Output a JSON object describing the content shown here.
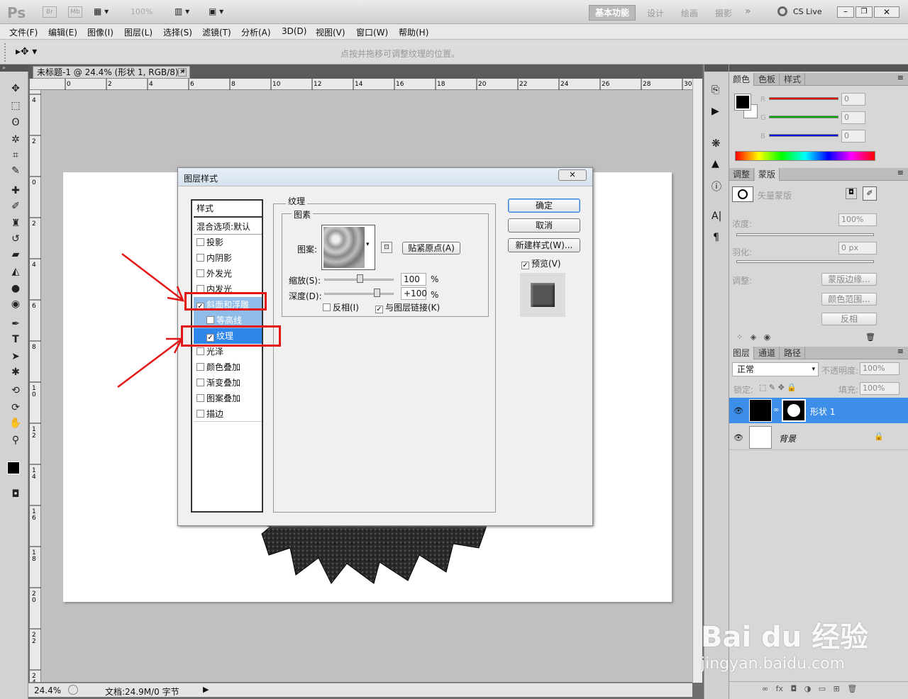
{
  "app": {
    "logo": "Ps",
    "br": "Br",
    "mb": "Mb",
    "zoom": "100%",
    "workspaces": [
      "基本功能",
      "设计",
      "绘画",
      "摄影"
    ],
    "more": "»",
    "cslive": "CS Live",
    "hint": "点按并拖移可调整纹理的位置。"
  },
  "menu": [
    "文件(F)",
    "编辑(E)",
    "图像(I)",
    "图层(L)",
    "选择(S)",
    "滤镜(T)",
    "分析(A)",
    "3D(D)",
    "视图(V)",
    "窗口(W)",
    "帮助(H)"
  ],
  "document": {
    "tab_title": "未标题-1 @ 24.4% (形状 1, RGB/8) *",
    "zoom": "24.4%",
    "doc_info": "文档:24.9M/0 字节"
  },
  "ruler": {
    "h_ticks": [
      "0",
      "2",
      "4",
      "6",
      "8",
      "10",
      "12",
      "14",
      "16",
      "18",
      "20",
      "22",
      "24",
      "26",
      "28",
      "30"
    ],
    "v_ticks": [
      "4",
      "2",
      "0",
      "2",
      "4",
      "6",
      "8",
      "1 0",
      "1 2",
      "1 4",
      "1 6",
      "1 8",
      "2 0",
      "2 2",
      "2 4"
    ]
  },
  "dialog": {
    "title": "图层样式",
    "styles_header": "样式",
    "blend_options": "混合选项:默认",
    "items": [
      {
        "label": "投影",
        "checked": false
      },
      {
        "label": "内阴影",
        "checked": false
      },
      {
        "label": "外发光",
        "checked": false
      },
      {
        "label": "内发光",
        "checked": false
      },
      {
        "label": "斜面和浮雕",
        "checked": true
      },
      {
        "label": "等高线",
        "checked": false
      },
      {
        "label": "纹理",
        "checked": true
      },
      {
        "label": "光泽",
        "checked": false
      },
      {
        "label": "颜色叠加",
        "checked": false
      },
      {
        "label": "渐变叠加",
        "checked": false
      },
      {
        "label": "图案叠加",
        "checked": false
      },
      {
        "label": "描边",
        "checked": false
      }
    ],
    "section_title": "纹理",
    "subsection": "图素",
    "pattern_label": "图案:",
    "snap_button": "贴紧原点(A)",
    "scale_label": "缩放(S):",
    "scale_value": "100",
    "depth_label": "深度(D):",
    "depth_value": "+100",
    "percent": "%",
    "invert_label": "反相(I)",
    "invert_checked": false,
    "link_label": "与图层链接(K)",
    "link_checked": true,
    "ok": "确定",
    "cancel": "取消",
    "new_style": "新建样式(W)...",
    "preview_label": "预览(V)",
    "preview_checked": true
  },
  "color_panel": {
    "tabs": [
      "颜色",
      "色板",
      "样式"
    ],
    "channels": [
      {
        "name": "R",
        "value": "0",
        "color": "#e00000"
      },
      {
        "name": "G",
        "value": "0",
        "color": "#00b000"
      },
      {
        "name": "B",
        "value": "0",
        "color": "#0000e0"
      }
    ]
  },
  "mask_panel": {
    "tabs": [
      "调整",
      "蒙版"
    ],
    "vector_mask": "矢量蒙版",
    "density_label": "浓度:",
    "density_value": "100%",
    "feather_label": "羽化:",
    "feather_value": "0 px",
    "refine_label": "调整:",
    "mask_edge": "蒙版边缘...",
    "color_range": "颜色范围...",
    "invert": "反相"
  },
  "layers_panel": {
    "tabs": [
      "图层",
      "通道",
      "路径"
    ],
    "blend_mode": "正常",
    "opacity_label": "不透明度:",
    "opacity": "100%",
    "lock_label": "锁定:",
    "fill_label": "填充:",
    "fill": "100%",
    "layers": [
      {
        "name": "形状 1",
        "selected": true
      },
      {
        "name": "背景",
        "selected": false
      }
    ]
  },
  "watermark": {
    "brand": "Bai du 经验",
    "url": "jingyan.baidu.com"
  }
}
